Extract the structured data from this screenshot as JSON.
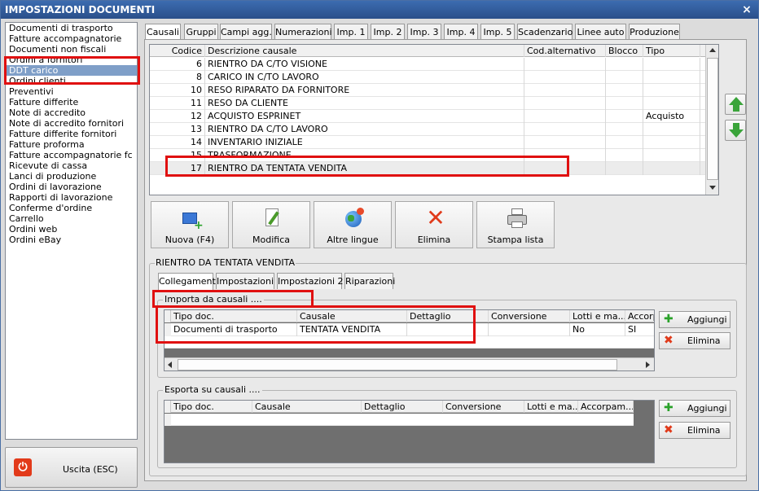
{
  "window": {
    "title": "IMPOSTAZIONI DOCUMENTI",
    "close_glyph": "×"
  },
  "sidebar": {
    "items": [
      {
        "label": "Documenti di trasporto",
        "selected": false
      },
      {
        "label": "Fatture accompagnatorie",
        "selected": false
      },
      {
        "label": "Documenti non fiscali",
        "selected": false
      },
      {
        "label": "Ordini a fornitori",
        "selected": false
      },
      {
        "label": "DDT carico",
        "selected": true
      },
      {
        "label": "Ordini clienti",
        "selected": false
      },
      {
        "label": "Preventivi",
        "selected": false
      },
      {
        "label": "Fatture differite",
        "selected": false
      },
      {
        "label": "Note di accredito",
        "selected": false
      },
      {
        "label": "Note di accredito fornitori",
        "selected": false
      },
      {
        "label": "Fatture differite fornitori",
        "selected": false
      },
      {
        "label": "Fatture proforma",
        "selected": false
      },
      {
        "label": "Fatture accompagnatorie fc",
        "selected": false
      },
      {
        "label": "Ricevute di cassa",
        "selected": false
      },
      {
        "label": "Lanci di produzione",
        "selected": false
      },
      {
        "label": "Ordini di lavorazione",
        "selected": false
      },
      {
        "label": "Rapporti di lavorazione",
        "selected": false
      },
      {
        "label": "Conferme d'ordine",
        "selected": false
      },
      {
        "label": "Carrello",
        "selected": false
      },
      {
        "label": "Ordini web",
        "selected": false
      },
      {
        "label": "Ordini eBay",
        "selected": false
      }
    ],
    "exit_label": "Uscita (ESC)"
  },
  "tabs": [
    {
      "label": "Causali",
      "active": true
    },
    {
      "label": "Gruppi"
    },
    {
      "label": "Campi agg."
    },
    {
      "label": "Numerazioni"
    },
    {
      "label": "Imp. 1"
    },
    {
      "label": "Imp. 2"
    },
    {
      "label": "Imp. 3"
    },
    {
      "label": "Imp. 4"
    },
    {
      "label": "Imp. 5"
    },
    {
      "label": "Scadenzario"
    },
    {
      "label": "Linee auto"
    },
    {
      "label": "Produzione"
    }
  ],
  "causali_grid": {
    "columns": [
      "Codice",
      "Descrizione causale",
      "Cod.alternativo",
      "Blocco",
      "Tipo"
    ],
    "rows": [
      {
        "codice": "6",
        "descrizione": "RIENTRO DA C/TO VISIONE",
        "cod_alt": "",
        "blocco": "",
        "tipo": ""
      },
      {
        "codice": "8",
        "descrizione": "CARICO IN C/TO LAVORO",
        "cod_alt": "",
        "blocco": "",
        "tipo": ""
      },
      {
        "codice": "10",
        "descrizione": "RESO RIPARATO DA FORNITORE",
        "cod_alt": "",
        "blocco": "",
        "tipo": ""
      },
      {
        "codice": "11",
        "descrizione": "RESO DA CLIENTE",
        "cod_alt": "",
        "blocco": "",
        "tipo": ""
      },
      {
        "codice": "12",
        "descrizione": "ACQUISTO ESPRINET",
        "cod_alt": "",
        "blocco": "",
        "tipo": "Acquisto"
      },
      {
        "codice": "13",
        "descrizione": "RIENTRO DA C/TO LAVORO",
        "cod_alt": "",
        "blocco": "",
        "tipo": ""
      },
      {
        "codice": "14",
        "descrizione": "INVENTARIO INIZIALE",
        "cod_alt": "",
        "blocco": "",
        "tipo": ""
      },
      {
        "codice": "15",
        "descrizione": "TRASFORMAZIONE",
        "cod_alt": "",
        "blocco": "",
        "tipo": ""
      },
      {
        "codice": "17",
        "descrizione": "RIENTRO DA TENTATA VENDITA",
        "cod_alt": "",
        "blocco": "",
        "tipo": ""
      }
    ]
  },
  "toolbar": {
    "nuova": "Nuova (F4)",
    "modifica": "Modifica",
    "altre_lingue": "Altre lingue",
    "elimina": "Elimina",
    "stampa": "Stampa lista"
  },
  "detail": {
    "title": "RIENTRO DA TENTATA VENDITA",
    "subtabs": [
      {
        "label": "Collegamenti",
        "active": true
      },
      {
        "label": "Impostazioni"
      },
      {
        "label": "Impostazioni 2"
      },
      {
        "label": "Riparazioni"
      }
    ],
    "importa": {
      "title": "Importa da causali ....",
      "columns": [
        "Tipo doc.",
        "Causale",
        "Dettaglio",
        "Conversione",
        "Lotti e ma...",
        "Accorp"
      ],
      "rows": [
        {
          "tipo": "Documenti di trasporto",
          "causale": "TENTATA VENDITA",
          "dettaglio": "",
          "conversione": "",
          "lotti": "No",
          "accorp": "SI"
        }
      ],
      "add_label": "Aggiungi",
      "del_label": "Elimina"
    },
    "esporta": {
      "title": "Esporta su causali ....",
      "columns": [
        "Tipo doc.",
        "Causale",
        "Dettaglio",
        "Conversione",
        "Lotti e ma...",
        "Accorpam..."
      ],
      "add_label": "Aggiungi",
      "del_label": "Elimina"
    }
  },
  "colors": {
    "title_bar": "#2f5a9a",
    "selection": "#7f9fc8",
    "highlight_box": "#e01010",
    "arrow_green": "#3aa43a"
  }
}
